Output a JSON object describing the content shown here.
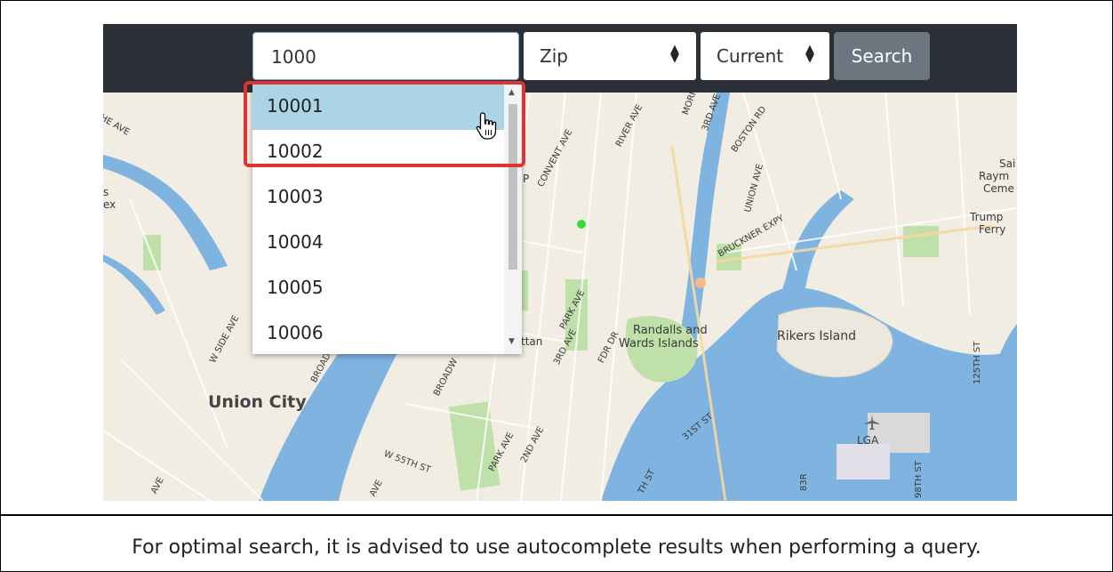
{
  "search": {
    "value": "1000"
  },
  "filters": {
    "type_label": "Zip",
    "time_label": "Current",
    "select_arrows": "⇕"
  },
  "search_button_label": "Search",
  "autocomplete": {
    "items": [
      "10001",
      "10002",
      "10003",
      "10004",
      "10005",
      "10006"
    ],
    "highlighted_index": 0
  },
  "map_labels": {
    "union_city": "Union City",
    "randalls": "Randalls and",
    "wards": "Wards Islands",
    "rikers": "Rikers Island",
    "lga": "LGA",
    "tan": "ttan",
    "p": "P",
    "convent": "CONVENT AVE",
    "river": "RIVER AVE",
    "morris": "MORR",
    "third": "3RD AVE",
    "boston": "BOSTON RD",
    "union_ave": "UNION AVE",
    "bruckner": "BRUCKNER EXPY",
    "park": "PARK AVE",
    "third2": "3RD AVE",
    "fdr": "FDR DR",
    "broadway": "BROADW",
    "broad": "BROAD",
    "w_side": "W SIDE AVE",
    "park2": "PARK AVE",
    "second": "2ND AVE",
    "w55": "W 55TH ST",
    "ave": "AVE",
    "st31": "31ST ST",
    "st125": "125TH ST",
    "st98": "98TH ST",
    "he_ave": "HE AVE",
    "sai": "Sai",
    "raym": "Raym",
    "ceme": "Ceme",
    "trump": "Trump",
    "ferry": "Ferry",
    "s": "s",
    "ex": "ex",
    "st83": "83R",
    "th_st": "TH ST",
    "av_l": "AVE"
  },
  "caption": "For optimal search, it is advised to use autocomplete results when performing a query."
}
